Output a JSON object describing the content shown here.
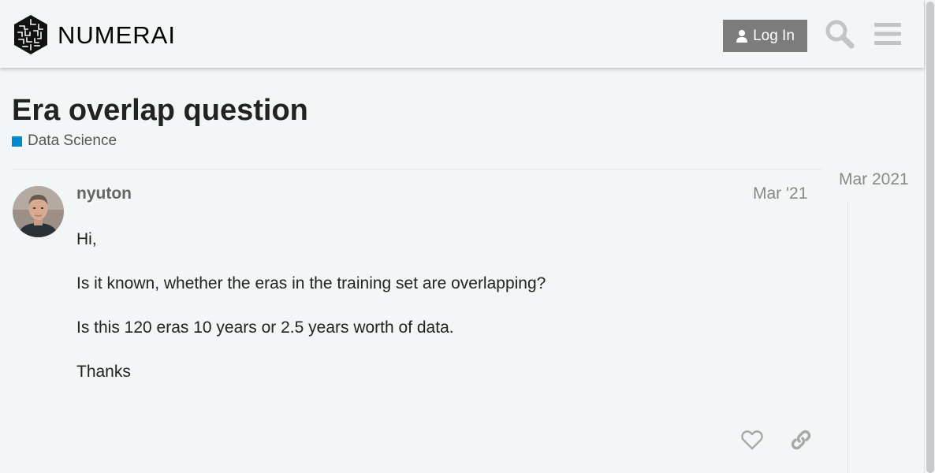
{
  "header": {
    "logo_text": "NUMERAI",
    "login_label": "Log In",
    "search_icon": "search-icon",
    "menu_icon": "hamburger-menu-icon"
  },
  "topic": {
    "title": "Era overlap question",
    "category": {
      "label": "Data Science",
      "color": "#0088cc"
    }
  },
  "post": {
    "username": "nyuton",
    "date": "Mar '21",
    "paragraphs": [
      "Hi,",
      "Is it known, whether the eras in the training set are overlapping?",
      "Is this 120 eras 10 years or 2.5 years worth of data.",
      "Thanks"
    ],
    "actions": [
      "heart-icon",
      "link-icon"
    ]
  },
  "timeline": {
    "date": "Mar 2021"
  },
  "colors": {
    "background": "#f2f6f7",
    "login_button": "#7c7c7c",
    "icon_gray": "#c2c4c6",
    "accent": "#0088cc"
  }
}
